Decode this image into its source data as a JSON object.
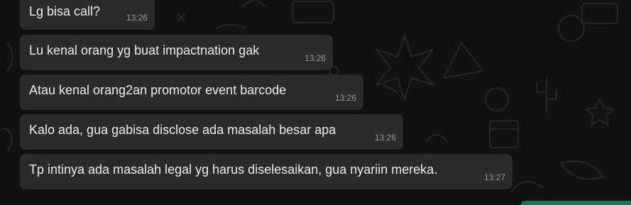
{
  "messages": [
    {
      "text": "Lg bisa call?",
      "time": "13:26"
    },
    {
      "text": "Lu kenal orang yg buat impactnation gak",
      "time": "13:26"
    },
    {
      "text": "Atau kenal orang2an promotor event barcode",
      "time": "13:26"
    },
    {
      "text": "Kalo ada, gua gabisa disclose ada masalah besar apa",
      "time": "13:26"
    },
    {
      "text": "Tp intinya ada masalah legal yg harus diselesaikan, gua nyariin mereka.",
      "time": "13:27"
    }
  ],
  "colors": {
    "background": "#111111",
    "bubble": "#2b2b2b",
    "text": "#ececec",
    "timestamp": "#9a9a9a",
    "accent_green": "#1f6f5c"
  }
}
